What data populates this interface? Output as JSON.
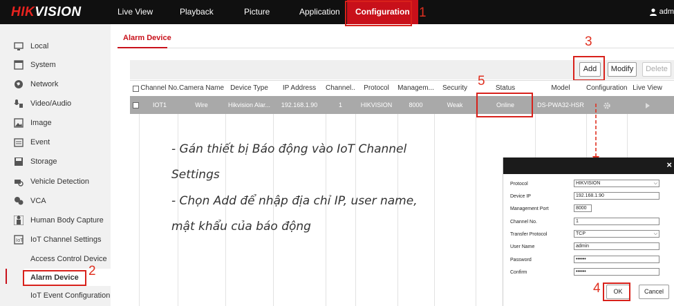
{
  "topbar": {
    "logo_red": "HIK",
    "logo_white": "VISION",
    "nav": [
      "Live View",
      "Playback",
      "Picture",
      "Application",
      "Configuration"
    ],
    "user": "adm",
    "accent": "#c8101a"
  },
  "annotations": [
    "1",
    "2",
    "3",
    "4",
    "5"
  ],
  "sidebar": {
    "items": [
      {
        "label": "Local",
        "icon": "monitor-icon"
      },
      {
        "label": "System",
        "icon": "window-icon"
      },
      {
        "label": "Network",
        "icon": "globe-icon"
      },
      {
        "label": "Video/Audio",
        "icon": "mic-icon"
      },
      {
        "label": "Image",
        "icon": "image-icon"
      },
      {
        "label": "Event",
        "icon": "calendar-icon"
      },
      {
        "label": "Storage",
        "icon": "save-icon"
      },
      {
        "label": "Vehicle Detection",
        "icon": "car-search-icon"
      },
      {
        "label": "VCA",
        "icon": "vca-icon"
      },
      {
        "label": "Human Body Capture",
        "icon": "person-icon"
      },
      {
        "label": "IoT Channel Settings",
        "icon": "iot-icon"
      }
    ],
    "subitems": [
      "Access Control Device",
      "Alarm Device",
      "IoT Event Configuration"
    ]
  },
  "content": {
    "tab": "Alarm Device",
    "buttons": {
      "add": "Add",
      "modify": "Modify",
      "delete": "Delete"
    },
    "columns": [
      "Channel No.",
      "Camera Name",
      "Device Type",
      "IP Address",
      "Channel...",
      "Protocol",
      "Managem...",
      "Security",
      "Status",
      "Model",
      "Configuration",
      "Live View"
    ],
    "row": {
      "channel_no": "IOT1",
      "camera_name": "Wire",
      "device_type": "Hikvision Alar...",
      "ip_address": "192.168.1.90",
      "channel": "1",
      "protocol": "HIKVISION",
      "management_port": "8000",
      "security": "Weak",
      "status": "Online",
      "model": "DS-PWA32-HSR"
    }
  },
  "note": {
    "line1": "- Gán thiết bị Báo động vào IoT Channel",
    "line2": "Settings",
    "line3": "- Chọn Add để nhập địa chỉ IP, user name,",
    "line4": "mật khẩu của báo động"
  },
  "dialog": {
    "close": "×",
    "fields": [
      {
        "label": "Protocol",
        "value": "HIKVISION",
        "select": true
      },
      {
        "label": "Device IP",
        "value": "192.168.1.90"
      },
      {
        "label": "Management Port",
        "value": "8000"
      },
      {
        "label": "Channel No.",
        "value": "1"
      },
      {
        "label": "Transfer Protocol",
        "value": "TCP",
        "select": true
      },
      {
        "label": "User Name",
        "value": "admin"
      },
      {
        "label": "Password",
        "value": "••••••"
      },
      {
        "label": "Confirm",
        "value": "••••••"
      }
    ],
    "ok": "OK",
    "cancel": "Cancel"
  }
}
